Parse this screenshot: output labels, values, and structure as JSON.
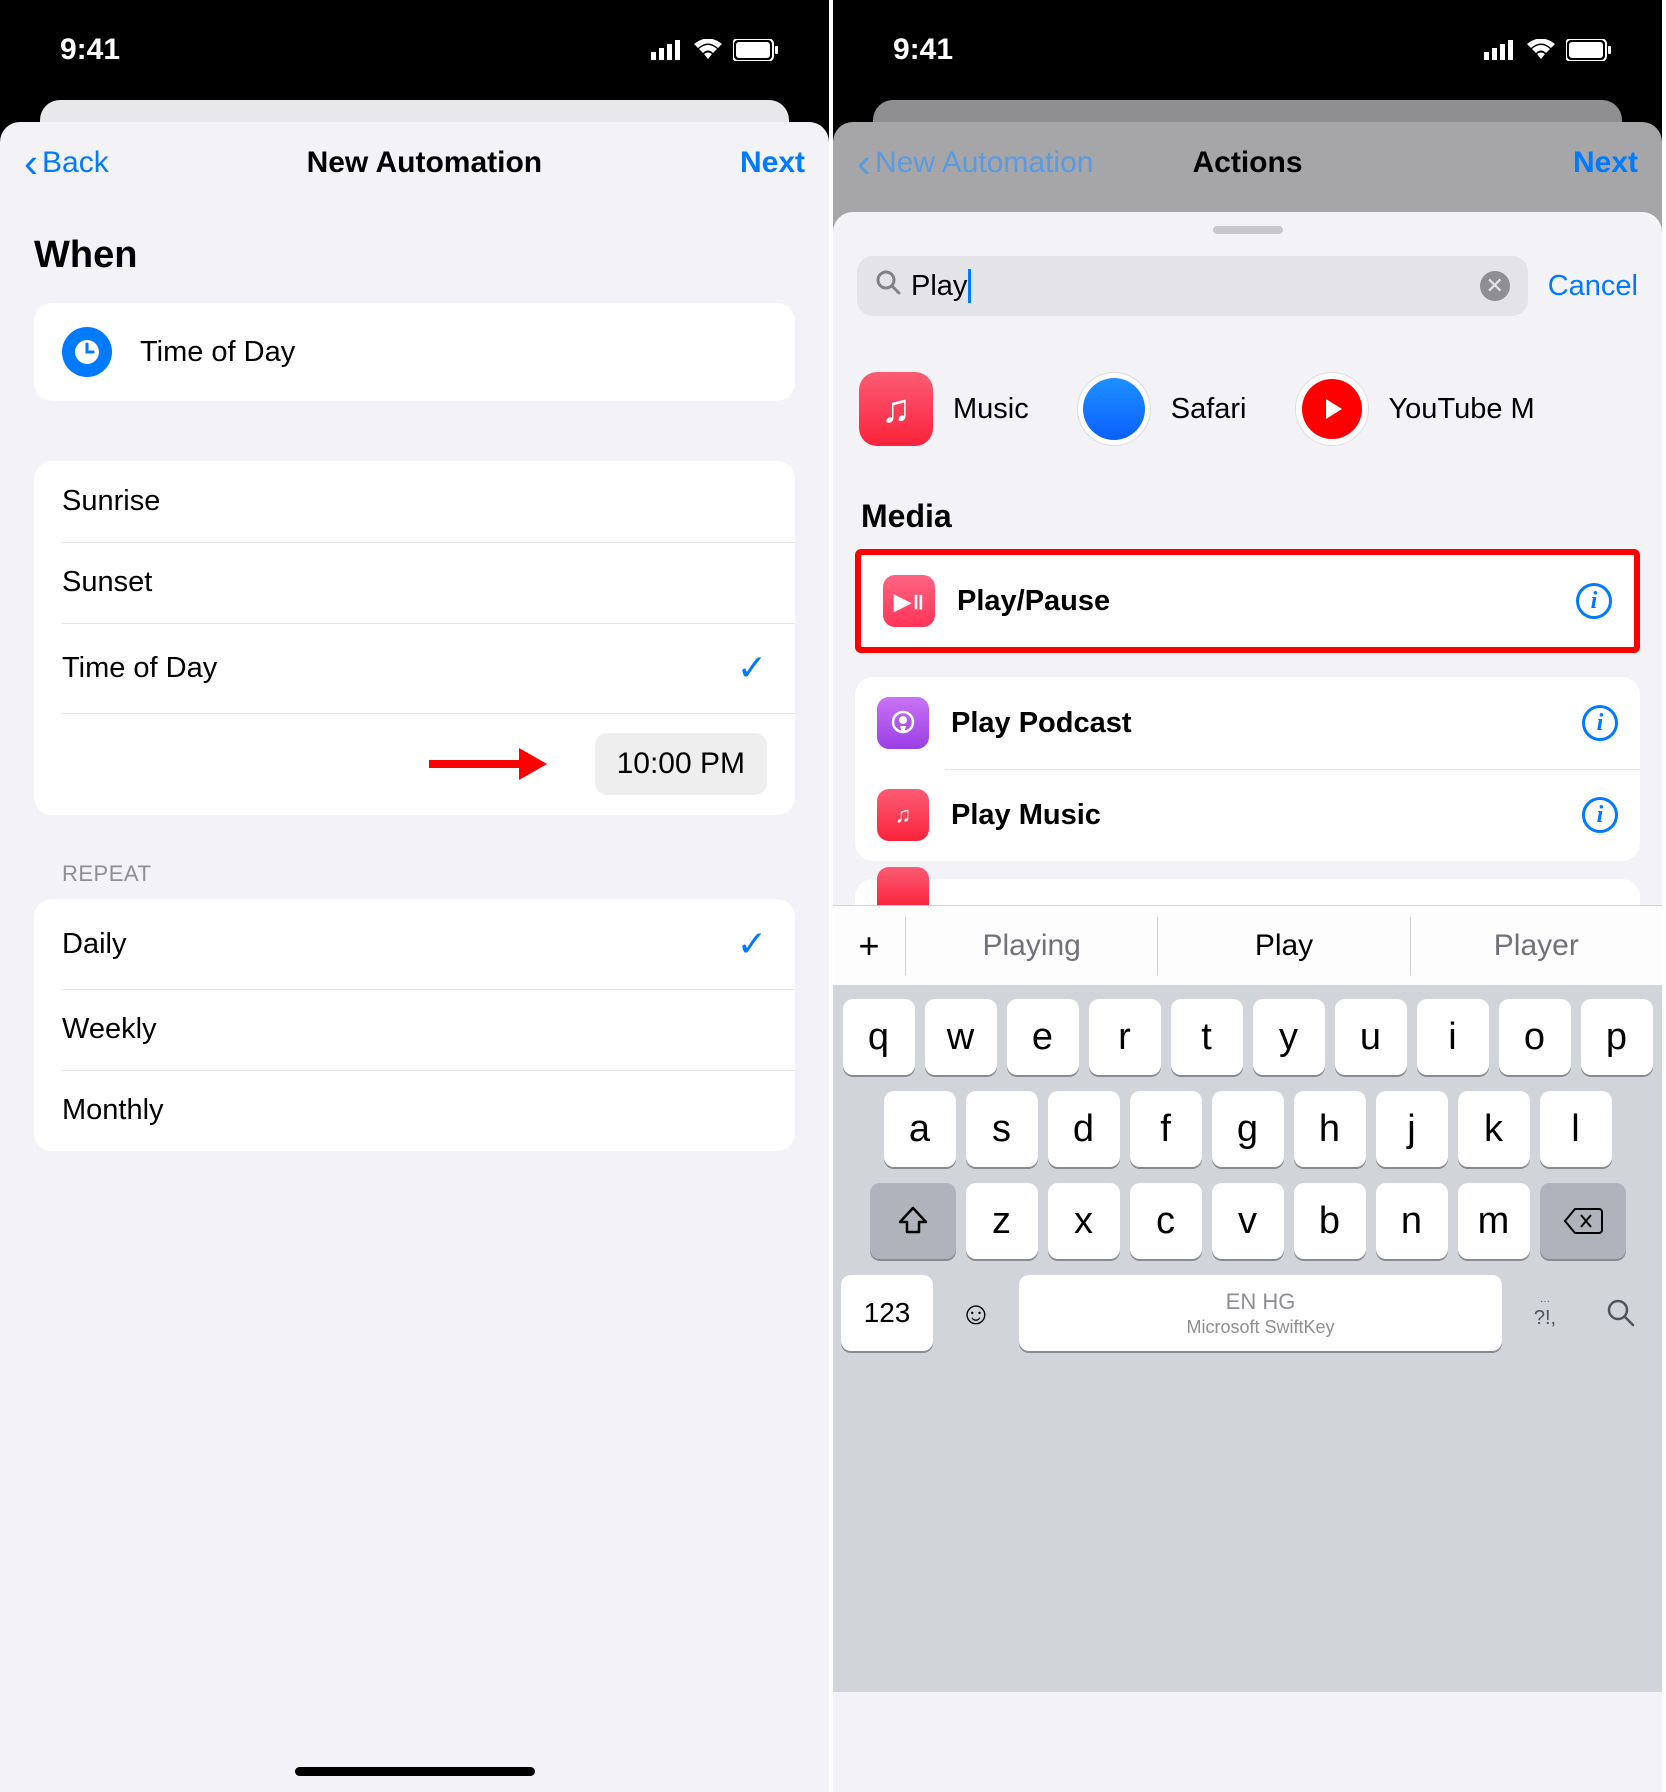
{
  "status": {
    "time": "9:41"
  },
  "left": {
    "nav": {
      "back": "Back",
      "title": "New Automation",
      "next": "Next"
    },
    "when_title": "When",
    "trigger_label": "Time of Day",
    "time_options": [
      "Sunrise",
      "Sunset",
      "Time of Day"
    ],
    "selected_time_option": "Time of Day",
    "time_value": "10:00 PM",
    "repeat_label": "REPEAT",
    "repeat_options": [
      "Daily",
      "Weekly",
      "Monthly"
    ],
    "selected_repeat": "Daily"
  },
  "right": {
    "nav": {
      "back": "New Automation",
      "title": "Actions",
      "next": "Next"
    },
    "search_value": "Play",
    "cancel": "Cancel",
    "apps": [
      {
        "name": "Music"
      },
      {
        "name": "Safari"
      },
      {
        "name": "YouTube M"
      }
    ],
    "section": "Media",
    "actions": [
      {
        "label": "Play/Pause"
      },
      {
        "label": "Play Podcast"
      },
      {
        "label": "Play Music"
      }
    ],
    "suggestions": [
      "Playing",
      "Play",
      "Player"
    ],
    "kb_rows": [
      [
        "q",
        "w",
        "e",
        "r",
        "t",
        "y",
        "u",
        "i",
        "o",
        "p"
      ],
      [
        "a",
        "s",
        "d",
        "f",
        "g",
        "h",
        "j",
        "k",
        "l"
      ],
      [
        "z",
        "x",
        "c",
        "v",
        "b",
        "n",
        "m"
      ]
    ],
    "kb_space_top": "EN HG",
    "kb_space_sub": "Microsoft SwiftKey",
    "kb_num": "123",
    "kb_punct": "?!,"
  }
}
